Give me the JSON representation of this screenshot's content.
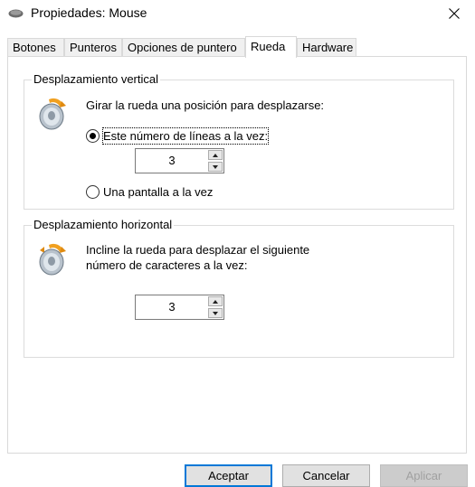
{
  "window": {
    "title": "Propiedades: Mouse",
    "close_icon": "close-icon"
  },
  "tabs": [
    {
      "label": "Botones"
    },
    {
      "label": "Punteros"
    },
    {
      "label": "Opciones de puntero"
    },
    {
      "label": "Rueda",
      "active": true
    },
    {
      "label": "Hardware"
    }
  ],
  "vertical": {
    "title": "Desplazamiento vertical",
    "description": "Girar la rueda una posición para desplazarse:",
    "option_lines": "Este número de líneas a la vez:",
    "option_lines_selected": true,
    "lines_value": "3",
    "option_page": "Una pantalla a la vez",
    "option_page_selected": false
  },
  "horizontal": {
    "title": "Desplazamiento horizontal",
    "description_line1": "Incline la rueda para desplazar el siguiente",
    "description_line2": "número de caracteres a la vez:",
    "chars_value": "3"
  },
  "buttons": {
    "ok": "Aceptar",
    "cancel": "Cancelar",
    "apply": "Aplicar"
  },
  "colors": {
    "accent": "#0078d7",
    "disabled_text": "#a0a0a0"
  }
}
